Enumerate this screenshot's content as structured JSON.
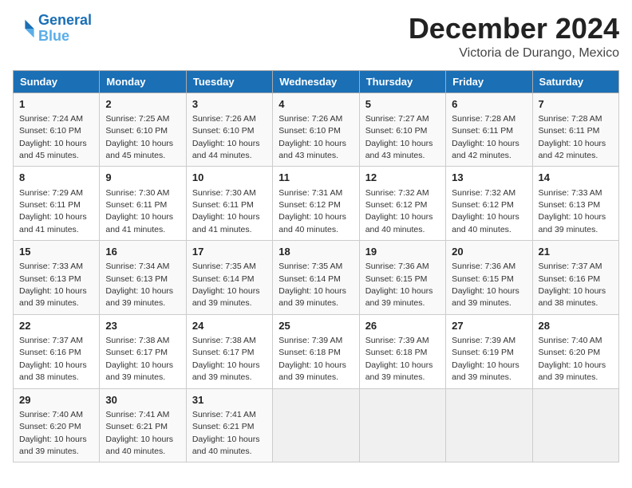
{
  "header": {
    "logo_line1": "General",
    "logo_line2": "Blue",
    "month_title": "December 2024",
    "location": "Victoria de Durango, Mexico"
  },
  "days_of_week": [
    "Sunday",
    "Monday",
    "Tuesday",
    "Wednesday",
    "Thursday",
    "Friday",
    "Saturday"
  ],
  "weeks": [
    [
      {
        "day": "1",
        "sunrise": "7:24 AM",
        "sunset": "6:10 PM",
        "daylight": "10 hours and 45 minutes."
      },
      {
        "day": "2",
        "sunrise": "7:25 AM",
        "sunset": "6:10 PM",
        "daylight": "10 hours and 45 minutes."
      },
      {
        "day": "3",
        "sunrise": "7:26 AM",
        "sunset": "6:10 PM",
        "daylight": "10 hours and 44 minutes."
      },
      {
        "day": "4",
        "sunrise": "7:26 AM",
        "sunset": "6:10 PM",
        "daylight": "10 hours and 43 minutes."
      },
      {
        "day": "5",
        "sunrise": "7:27 AM",
        "sunset": "6:10 PM",
        "daylight": "10 hours and 43 minutes."
      },
      {
        "day": "6",
        "sunrise": "7:28 AM",
        "sunset": "6:11 PM",
        "daylight": "10 hours and 42 minutes."
      },
      {
        "day": "7",
        "sunrise": "7:28 AM",
        "sunset": "6:11 PM",
        "daylight": "10 hours and 42 minutes."
      }
    ],
    [
      {
        "day": "8",
        "sunrise": "7:29 AM",
        "sunset": "6:11 PM",
        "daylight": "10 hours and 41 minutes."
      },
      {
        "day": "9",
        "sunrise": "7:30 AM",
        "sunset": "6:11 PM",
        "daylight": "10 hours and 41 minutes."
      },
      {
        "day": "10",
        "sunrise": "7:30 AM",
        "sunset": "6:11 PM",
        "daylight": "10 hours and 41 minutes."
      },
      {
        "day": "11",
        "sunrise": "7:31 AM",
        "sunset": "6:12 PM",
        "daylight": "10 hours and 40 minutes."
      },
      {
        "day": "12",
        "sunrise": "7:32 AM",
        "sunset": "6:12 PM",
        "daylight": "10 hours and 40 minutes."
      },
      {
        "day": "13",
        "sunrise": "7:32 AM",
        "sunset": "6:12 PM",
        "daylight": "10 hours and 40 minutes."
      },
      {
        "day": "14",
        "sunrise": "7:33 AM",
        "sunset": "6:13 PM",
        "daylight": "10 hours and 39 minutes."
      }
    ],
    [
      {
        "day": "15",
        "sunrise": "7:33 AM",
        "sunset": "6:13 PM",
        "daylight": "10 hours and 39 minutes."
      },
      {
        "day": "16",
        "sunrise": "7:34 AM",
        "sunset": "6:13 PM",
        "daylight": "10 hours and 39 minutes."
      },
      {
        "day": "17",
        "sunrise": "7:35 AM",
        "sunset": "6:14 PM",
        "daylight": "10 hours and 39 minutes."
      },
      {
        "day": "18",
        "sunrise": "7:35 AM",
        "sunset": "6:14 PM",
        "daylight": "10 hours and 39 minutes."
      },
      {
        "day": "19",
        "sunrise": "7:36 AM",
        "sunset": "6:15 PM",
        "daylight": "10 hours and 39 minutes."
      },
      {
        "day": "20",
        "sunrise": "7:36 AM",
        "sunset": "6:15 PM",
        "daylight": "10 hours and 39 minutes."
      },
      {
        "day": "21",
        "sunrise": "7:37 AM",
        "sunset": "6:16 PM",
        "daylight": "10 hours and 38 minutes."
      }
    ],
    [
      {
        "day": "22",
        "sunrise": "7:37 AM",
        "sunset": "6:16 PM",
        "daylight": "10 hours and 38 minutes."
      },
      {
        "day": "23",
        "sunrise": "7:38 AM",
        "sunset": "6:17 PM",
        "daylight": "10 hours and 39 minutes."
      },
      {
        "day": "24",
        "sunrise": "7:38 AM",
        "sunset": "6:17 PM",
        "daylight": "10 hours and 39 minutes."
      },
      {
        "day": "25",
        "sunrise": "7:39 AM",
        "sunset": "6:18 PM",
        "daylight": "10 hours and 39 minutes."
      },
      {
        "day": "26",
        "sunrise": "7:39 AM",
        "sunset": "6:18 PM",
        "daylight": "10 hours and 39 minutes."
      },
      {
        "day": "27",
        "sunrise": "7:39 AM",
        "sunset": "6:19 PM",
        "daylight": "10 hours and 39 minutes."
      },
      {
        "day": "28",
        "sunrise": "7:40 AM",
        "sunset": "6:20 PM",
        "daylight": "10 hours and 39 minutes."
      }
    ],
    [
      {
        "day": "29",
        "sunrise": "7:40 AM",
        "sunset": "6:20 PM",
        "daylight": "10 hours and 39 minutes."
      },
      {
        "day": "30",
        "sunrise": "7:41 AM",
        "sunset": "6:21 PM",
        "daylight": "10 hours and 40 minutes."
      },
      {
        "day": "31",
        "sunrise": "7:41 AM",
        "sunset": "6:21 PM",
        "daylight": "10 hours and 40 minutes."
      },
      null,
      null,
      null,
      null
    ]
  ]
}
